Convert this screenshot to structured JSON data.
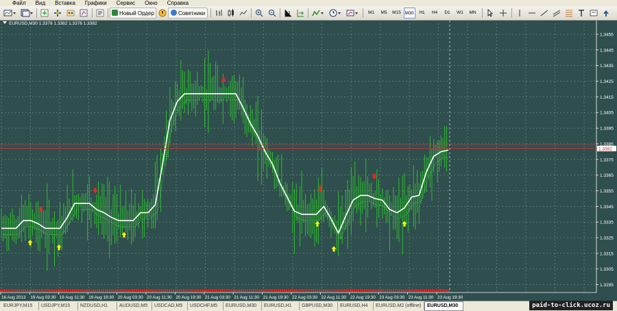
{
  "menu": [
    "Файл",
    "Вид",
    "Вставка",
    "Графики",
    "Сервис",
    "Окно",
    "Справка"
  ],
  "toolbar": {
    "new_order": "Новый Ордер",
    "advisors": "Советники",
    "timeframes": [
      "M1",
      "M5",
      "M15",
      "M30",
      "H1",
      "H4",
      "D1",
      "W1",
      "MN"
    ],
    "active_timeframe": "M30"
  },
  "chart": {
    "symbol_info": "EURUSD,M30  1.3378 1.3382 1.3376 1.3382",
    "price_labels": [
      "1.3455",
      "1.3445",
      "1.3435",
      "1.3425",
      "1.3415",
      "1.3405",
      "1.3395",
      "1.3385",
      "1.3375",
      "1.3365",
      "1.3355",
      "1.3345",
      "1.3335",
      "1.3325",
      "1.3315",
      "1.3305",
      "1.3295"
    ],
    "current_price": "1.3382",
    "time_labels": [
      "16 Aug 2013",
      "19 Aug 03:30",
      "19 Aug 11:30",
      "19 Aug 19:30",
      "20 Aug 03:30",
      "20 Aug 11:30",
      "20 Aug 19:30",
      "21 Aug 03:30",
      "21 Aug 11:30",
      "21 Aug 19:30",
      "22 Aug 03:30",
      "22 Aug 11:30",
      "22 Aug 19:30",
      "23 Aug 03:30",
      "23 Aug 11:30",
      "23 Aug 19:30"
    ],
    "colors": {
      "background": "#2f4e4e",
      "bars": "#2bbf2b",
      "line": "#ffffff",
      "buy_arrow": "#ffff00",
      "sell_arrow": "#ff2020",
      "price_line": "#d03030",
      "grid": "#8aa0a0"
    }
  },
  "chart_data": {
    "type": "line",
    "title": "",
    "xlabel": "",
    "ylabel": "",
    "ylim": [
      1.329,
      1.3462
    ],
    "series": [
      {
        "values": [
          1.3331,
          1.3331,
          1.3331,
          1.3336,
          1.3336,
          1.3334,
          1.3331,
          1.3331,
          1.3331,
          1.3338,
          1.3347,
          1.3347,
          1.3347,
          1.3343,
          1.3341,
          1.3338,
          1.3336,
          1.3336,
          1.3336,
          1.3341,
          1.3341,
          1.3346,
          1.3372,
          1.34,
          1.3412,
          1.3417,
          1.3417,
          1.3417,
          1.3417,
          1.3417,
          1.3417,
          1.3417,
          1.3417,
          1.3408,
          1.3398,
          1.339,
          1.338,
          1.3372,
          1.336,
          1.3351,
          1.3342,
          1.334,
          1.334,
          1.334,
          1.3345,
          1.3337,
          1.3328,
          1.3339,
          1.3349,
          1.3352,
          1.3352,
          1.335,
          1.3349,
          1.3343,
          1.3341,
          1.3344,
          1.3351,
          1.3352,
          1.3367,
          1.3377,
          1.338,
          1.3381
        ]
      }
    ],
    "buy_signal_prices": [
      1.3328,
      1.3325,
      1.3333,
      1.334,
      1.3324,
      1.334
    ],
    "sell_signal_prices": [
      1.3337,
      1.3349,
      1.342,
      1.335,
      1.3358
    ]
  }
}
